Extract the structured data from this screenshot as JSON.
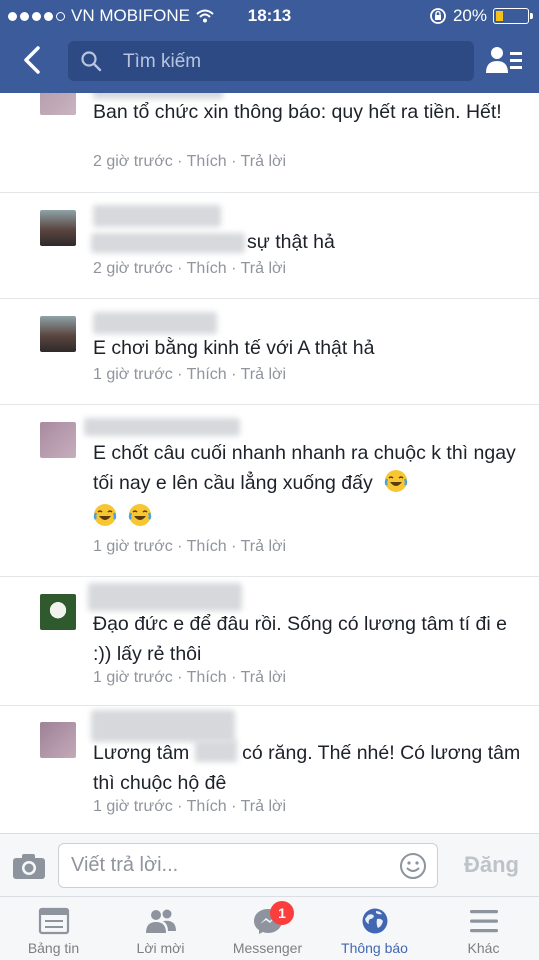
{
  "status_bar": {
    "carrier": "VN MOBIFONE",
    "time": "18:13",
    "battery": "20%"
  },
  "nav": {
    "search_placeholder": "Tìm kiếm"
  },
  "comments": [
    {
      "text": "Ban tổ chức xin thông báo: quy hết ra tiền. Hết!",
      "time": "2 giờ trước",
      "like": "Thích",
      "reply": "Trả lời"
    },
    {
      "text": "sự thật hả",
      "time": "2 giờ trước",
      "like": "Thích",
      "reply": "Trả lời"
    },
    {
      "text": "E chơi bằng kinh tế với A thật hả",
      "time": "1 giờ trước",
      "like": "Thích",
      "reply": "Trả lời"
    },
    {
      "text": "E chốt câu cuối nhanh nhanh ra chuộc k thì ngay tối nay e lên cầu lẳng xuống đấy",
      "time": "1 giờ trước",
      "like": "Thích",
      "reply": "Trả lời"
    },
    {
      "text": "Đạo đức e để đâu rồi. Sống có lương tâm tí đi e :)) lấy rẻ thôi",
      "time": "1 giờ trước",
      "like": "Thích",
      "reply": "Trả lời"
    },
    {
      "text_a": "Lương tâm",
      "text_b": "có răng. Thế nhé! Có lương tâm thì chuộc hộ đê",
      "time": "1 giờ trước",
      "like": "Thích",
      "reply": "Trả lời"
    }
  ],
  "separator": "·",
  "reply_bar": {
    "placeholder": "Viết trả lời...",
    "post_label": "Đăng"
  },
  "tabs": [
    {
      "label": "Bảng tin",
      "icon": "news-feed-icon"
    },
    {
      "label": "Lời mời",
      "icon": "friend-requests-icon"
    },
    {
      "label": "Messenger",
      "icon": "messenger-icon",
      "badge": "1"
    },
    {
      "label": "Thông báo",
      "icon": "globe-icon",
      "active": true
    },
    {
      "label": "Khác",
      "icon": "menu-icon"
    }
  ],
  "colors": {
    "header": "#3b5b9a",
    "search_bg": "#2d4a84",
    "active_tab": "#4267b2",
    "meta_text": "#90949c",
    "badge": "#fa3e3e"
  }
}
